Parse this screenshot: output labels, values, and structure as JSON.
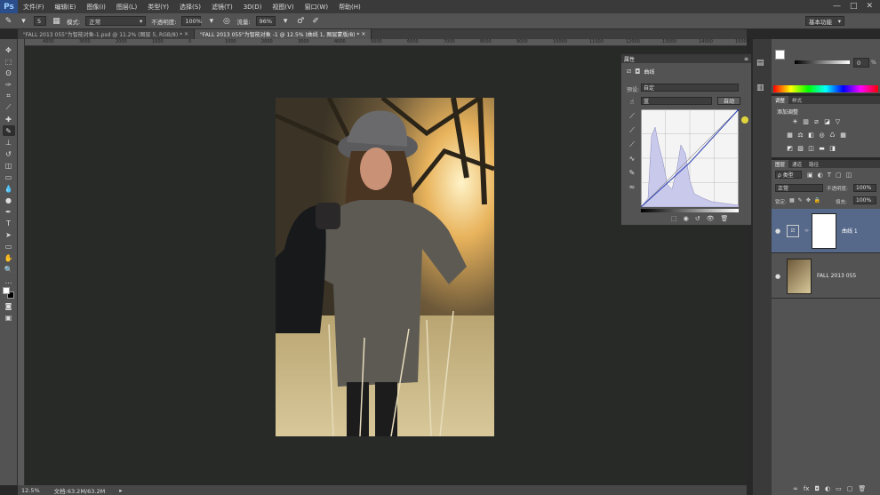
{
  "app": {
    "logo": "Ps"
  },
  "menu": [
    "文件(F)",
    "编辑(E)",
    "图像(I)",
    "图层(L)",
    "类型(Y)",
    "选择(S)",
    "滤镜(T)",
    "3D(D)",
    "视图(V)",
    "窗口(W)",
    "帮助(H)"
  ],
  "window_controls": [
    "—",
    "□",
    "✕"
  ],
  "options": {
    "mode_label": "模式:",
    "mode_value": "正常",
    "opacity_label": "不透明度:",
    "opacity_value": "100%",
    "flow_label": "流量:",
    "flow_value": "96%",
    "brush_size": "5",
    "workspace": "基本功能"
  },
  "tabs": [
    {
      "label": "\"FALL 2013 055\"为智能对象-1.psd @ 11.2% (图层 5, RGB/8) *",
      "close": "×"
    },
    {
      "label": "\"FALL 2013 055\"为智能对象 -1 @ 12.5% (曲线 1, 图层蒙版/8) *",
      "close": "×"
    }
  ],
  "ruler_marks": [
    "4000",
    "3000",
    "2000",
    "1000",
    "0",
    "1000",
    "2000",
    "3000",
    "4000",
    "5000",
    "6000",
    "7000",
    "8000",
    "9000",
    "10000",
    "11000",
    "12000",
    "13000",
    "14000",
    "15000"
  ],
  "status": {
    "zoom": "12.5%",
    "doc": "文档:63.2M/63.2M"
  },
  "properties": {
    "title": "属性",
    "panel_name": "曲线",
    "preset_label": "预设:",
    "preset_value": "自定",
    "channel_value": "蓝",
    "auto_button": "自动"
  },
  "color_panel": {
    "value": "0",
    "percent": "%"
  },
  "adjustments": {
    "tabs": [
      "调整",
      "样式"
    ],
    "add_label": "添加调整"
  },
  "layers_panel": {
    "tabs": [
      "图层",
      "通道",
      "路径"
    ],
    "kind_label": "ρ 类型",
    "blend_value": "正常",
    "opacity_label": "不透明度:",
    "opacity_value": "100%",
    "lock_label": "锁定:",
    "fill_label": "填充:",
    "fill_value": "100%",
    "layers": [
      {
        "name": "曲线 1"
      },
      {
        "name": "FALL 2013 055"
      }
    ]
  },
  "colors": {
    "accent_blue": "#2b4d8a",
    "selected_layer": "#56698a",
    "histogram": "#c9c9ec"
  }
}
